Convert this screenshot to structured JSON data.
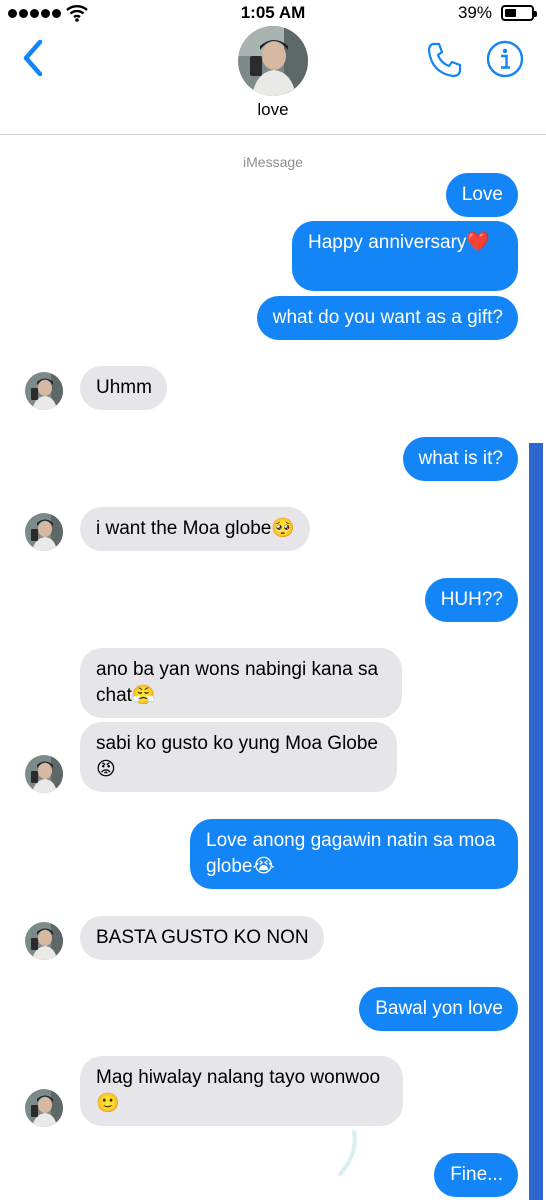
{
  "status": {
    "time": "1:05 AM",
    "battery": "39%",
    "battery_level": 0.39
  },
  "header": {
    "contact_name": "love"
  },
  "service_label": "iMessage",
  "colors": {
    "accent": "#1485f6",
    "incoming": "#e6e5ea",
    "scrollbar": "#2f66d0"
  },
  "messages": [
    {
      "dir": "out",
      "text": "Love"
    },
    {
      "dir": "out",
      "text": "Happy anniversary❤️"
    },
    {
      "dir": "out",
      "text": "what do you want as a gift?"
    },
    {
      "dir": "in",
      "text": "Uhmm"
    },
    {
      "dir": "out",
      "text": "what is it?"
    },
    {
      "dir": "in",
      "text": "i want the Moa globe🥺"
    },
    {
      "dir": "out",
      "text": "HUH??"
    },
    {
      "dir": "in",
      "text": "ano ba yan wons nabingi kana sa chat😤"
    },
    {
      "dir": "in",
      "text": "sabi ko gusto ko yung Moa Globe 😡"
    },
    {
      "dir": "out",
      "text": "Love anong gagawin natin sa moa globe😭"
    },
    {
      "dir": "in",
      "text": "BASTA GUSTO KO NON"
    },
    {
      "dir": "out",
      "text": "Bawal yon love"
    },
    {
      "dir": "in",
      "text": "Mag hiwalay nalang tayo wonwoo 🙂"
    },
    {
      "dir": "out",
      "text": "Fine..."
    }
  ]
}
